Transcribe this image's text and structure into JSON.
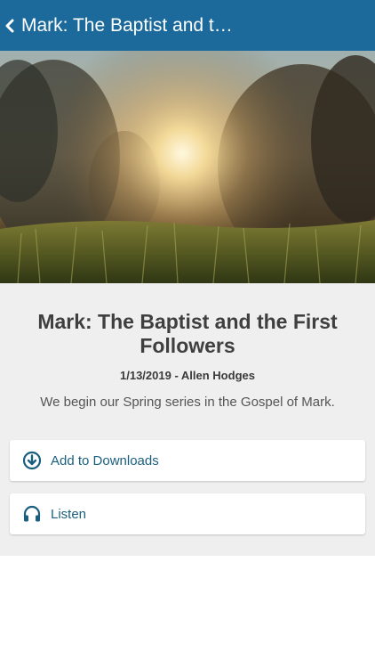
{
  "header": {
    "title": "Mark: The Baptist and t…",
    "background_color": "#1b6a9b"
  },
  "hero": {
    "image": "sunset-grass-photo"
  },
  "sermon": {
    "title": "Mark: The Baptist and the First Followers",
    "meta": "1/13/2019 - Allen Hodges",
    "description": "We begin our Spring series in the Gospel of Mark."
  },
  "actions": [
    {
      "label": "Add to Downloads",
      "icon": "download-circle-icon"
    },
    {
      "label": "Listen",
      "icon": "headphones-icon"
    }
  ],
  "colors": {
    "accent": "#1b5f7f",
    "panel": "#efefef"
  }
}
